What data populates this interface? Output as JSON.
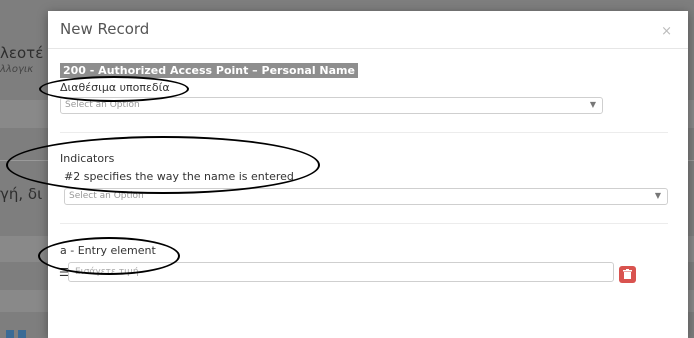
{
  "background": {
    "text_1": "λεοτέ",
    "text_2": "λλογικ",
    "text_3": "γή, δι"
  },
  "modal": {
    "title": "New Record",
    "close_glyph": "×"
  },
  "field": {
    "header": "200 - Authorized Access Point – Personal Name",
    "subfields_label": "Διαθέσιμα υποπεδία",
    "subfields_placeholder": "Select an Option"
  },
  "indicators": {
    "label": "Indicators",
    "note": "#2 specifies the way the name is entered",
    "placeholder": "Select an Option"
  },
  "subfield_a": {
    "label": "a - Entry element",
    "placeholder": "Εισάγετε τιμή"
  },
  "icons": {
    "close": "close-icon",
    "select_arrow": "chevron-down-icon",
    "drag": "drag-handle-icon",
    "delete": "trash-icon"
  },
  "colors": {
    "overlay_bg": "#7f7f7f",
    "header_badge": "#8e8e8e",
    "delete_button": "#d9534f"
  }
}
